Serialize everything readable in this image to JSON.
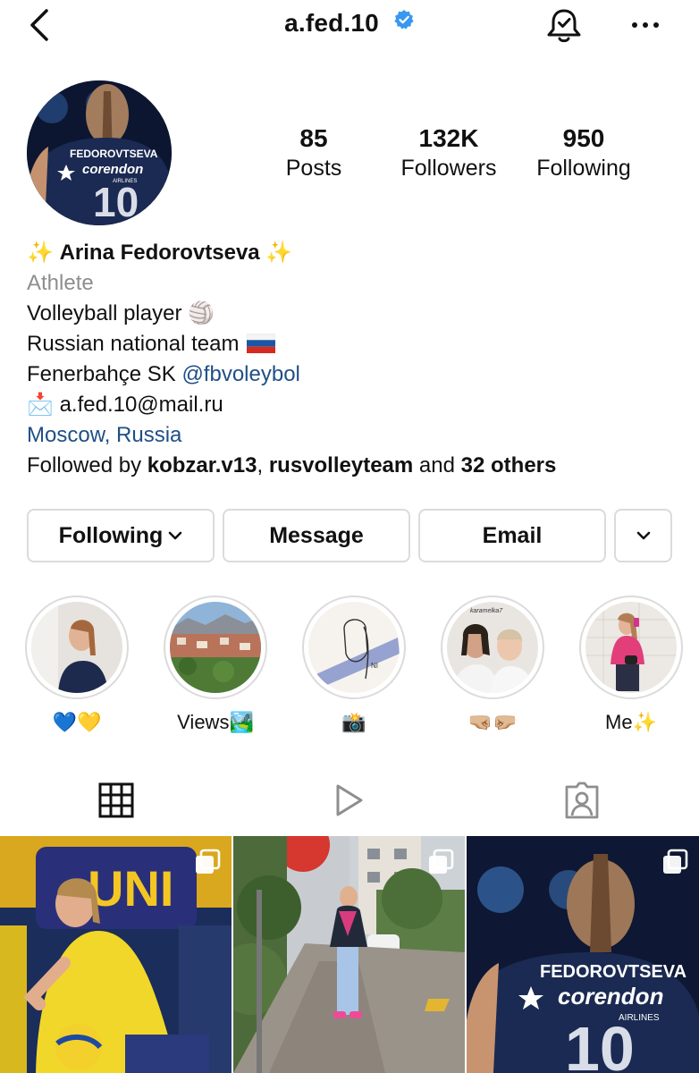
{
  "header": {
    "username": "a.fed.10",
    "back_icon": "chevron-left-icon",
    "verified_icon": "verified-badge-icon",
    "notification_icon": "bell-check-icon",
    "more_icon": "more-horizontal-icon"
  },
  "profile": {
    "avatar_text": {
      "name": "FEDOROVTSEVA",
      "brand": "corendon",
      "sub": "AIRLINES",
      "number": "10"
    },
    "stats": [
      {
        "value": "85",
        "label": "Posts"
      },
      {
        "value": "132K",
        "label": "Followers"
      },
      {
        "value": "950",
        "label": "Following"
      }
    ],
    "sparkle_left": "✨",
    "name": "Arina Fedorovtseva",
    "sparkle_right": "✨",
    "category": "Athlete",
    "bio_line1": "Volleyball player 🏐",
    "bio_line2": "Russian national team",
    "bio_line3_text": "Fenerbahçe SK ",
    "bio_line3_link": "@fbvoleybol",
    "email_emoji": "📩",
    "email": "a.fed.10@mail.ru",
    "location": "Moscow, Russia",
    "followed_prefix": "Followed by ",
    "followed_user1": "kobzar.v13",
    "followed_sep": ", ",
    "followed_user2": "rusvolleyteam",
    "followed_mid": " and ",
    "followed_others": "32 others"
  },
  "buttons": {
    "following": "Following",
    "message": "Message",
    "email": "Email"
  },
  "highlights": [
    {
      "caption": "💙💛"
    },
    {
      "caption": "Views🏞️"
    },
    {
      "caption": "📸"
    },
    {
      "caption": "🤜🏼🤛🏼"
    },
    {
      "caption": "Me✨"
    }
  ],
  "highlight3_text": "NI",
  "highlight4_text": "karamelka7",
  "tabs": [
    "grid-icon",
    "reels-icon",
    "tagged-icon"
  ],
  "grid": {
    "post1_text": "UNI",
    "post3_text": {
      "name": "FEDOROVTSEVA",
      "brand": "corendon",
      "sub": "AIRLINES",
      "number": "10"
    }
  },
  "colors": {
    "link": "#1f4f86",
    "verified": "#3897f0",
    "border": "#dbdbdb",
    "muted": "#8e8e8e"
  }
}
